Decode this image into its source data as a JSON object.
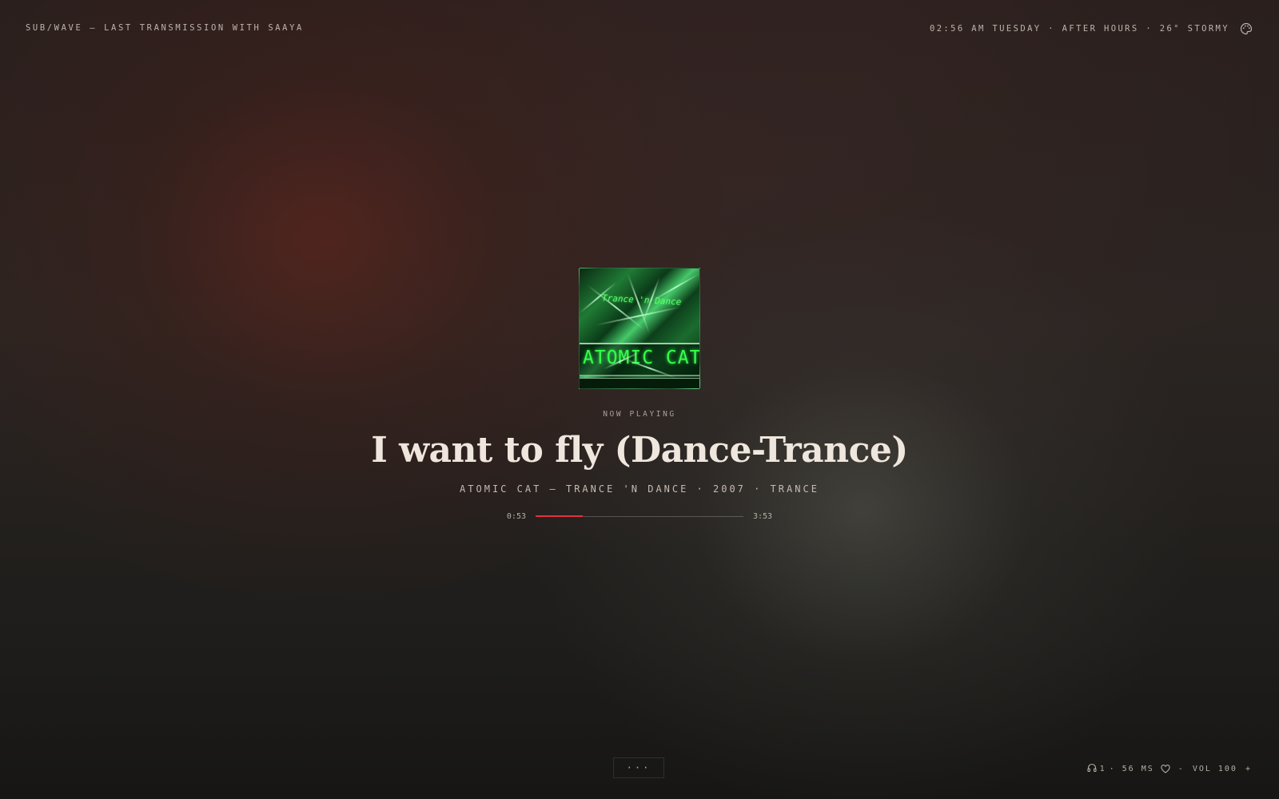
{
  "header": {
    "station": "SUB/WAVE — LAST TRANSMISSION WITH SAAYA",
    "status": "02:56 AM TUESDAY · AFTER HOURS · 26° STORMY",
    "theme_icon": "palette-icon"
  },
  "album_art": {
    "script_text": "Trance 'n Dance",
    "band_text": "ATOMIC CAT"
  },
  "player": {
    "label": "NOW PLAYING",
    "title": "I want to fly (Dance-Trance)",
    "meta": "ATOMIC CAT — TRANCE 'N DANCE · 2007 · TRANCE",
    "elapsed": "0:53",
    "duration": "3:53",
    "progress_fraction": 0.228,
    "accent_color": "#e0333c"
  },
  "footer": {
    "more_label": "···",
    "listeners": "1",
    "latency": "· 56 MS",
    "vol_down": "-",
    "vol_label": "VOL 100",
    "vol_up": "+",
    "listener_icon": "headphones-icon",
    "favorite_icon": "heart-icon"
  }
}
